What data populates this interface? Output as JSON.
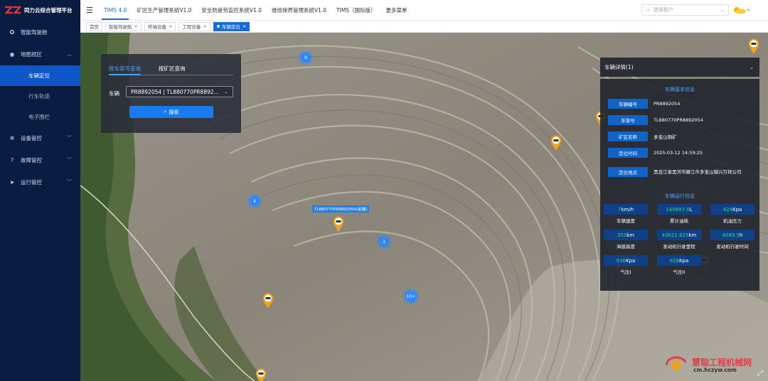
{
  "app": {
    "title": "同力云综合管理平台"
  },
  "sidebar": {
    "items": [
      {
        "label": "智能驾驶舱",
        "icon": "dashboard-icon"
      },
      {
        "label": "地图视区",
        "icon": "globe-icon",
        "expanded": true
      },
      {
        "label": "车辆定位",
        "sub": true,
        "active": true
      },
      {
        "label": "行车轨迹",
        "sub": true
      },
      {
        "label": "电子围栏",
        "sub": true
      },
      {
        "label": "设备管控",
        "icon": "gear-icon"
      },
      {
        "label": "故障管控",
        "icon": "help-icon"
      },
      {
        "label": "运行管控",
        "icon": "send-icon"
      }
    ]
  },
  "topnav": {
    "items": [
      "TIMS 4.0",
      "矿区生产管理系统V1.0",
      "安全防疲劳监控系统V1.0",
      "维修保养管理系统V1.0",
      "TIMS（国际版）",
      "更多菜单"
    ],
    "tenant_placeholder": "选择租户"
  },
  "tabs": [
    {
      "label": "首页",
      "closable": false
    },
    {
      "label": "智能驾驶舱",
      "closable": true
    },
    {
      "label": "终端设备",
      "closable": true
    },
    {
      "label": "工程设备",
      "closable": true
    },
    {
      "label": "车辆定位",
      "closable": true,
      "active": true
    }
  ],
  "search": {
    "tabs": [
      "按车架号查询",
      "按矿区查询"
    ],
    "vehicle_label": "车辆",
    "vehicle_value": "PR8892054 | TL880770PR8892...",
    "button": "搜索"
  },
  "map": {
    "clusters": [
      "9",
      "4",
      "3",
      "10+"
    ],
    "vehicle_label": "TL880770PR8892054(前端)"
  },
  "detail": {
    "title": "车辆详情(1)",
    "basic_title": "车辆基本信息",
    "basic": [
      {
        "label": "车辆编号",
        "value": "PR8892054"
      },
      {
        "label": "车架号",
        "value": "TL880770PR8892054"
      },
      {
        "label": "矿区名称",
        "value": "多宝山铜矿"
      },
      {
        "label": "定位时间",
        "value": "2025-03-12 14:59:25"
      },
      {
        "label": "定位地点",
        "value": "黑龙江省黑河市嫩江市多宝山镇兴万祥公司"
      }
    ],
    "run_title": "车辆运行信息",
    "run": [
      {
        "num": "7",
        "unit": "km/h",
        "label": "车辆速度"
      },
      {
        "num": "140687.0",
        "unit": "L",
        "label": "累计油耗"
      },
      {
        "num": "424",
        "unit": "Kpa",
        "label": "机油压力"
      },
      {
        "num": "353",
        "unit": "km",
        "label": "海拔高度"
      },
      {
        "num": "43621.625",
        "unit": "km",
        "label": "发动机行驶里程"
      },
      {
        "num": "4089.5",
        "unit": "h",
        "label": "发动机行驶时间"
      },
      {
        "num": "936",
        "unit": "Kpa",
        "label": "气压I"
      },
      {
        "num": "928",
        "unit": "Kpa",
        "label": "气压II"
      }
    ]
  },
  "watermark": {
    "name": "慧聪工程机械网",
    "url": "cm.hczyw.com"
  },
  "colors": {
    "sidebar": "#0a1c41",
    "accent": "#1a6bd8",
    "active_menu": "#0f56c9",
    "value_green": "#39d96b"
  }
}
